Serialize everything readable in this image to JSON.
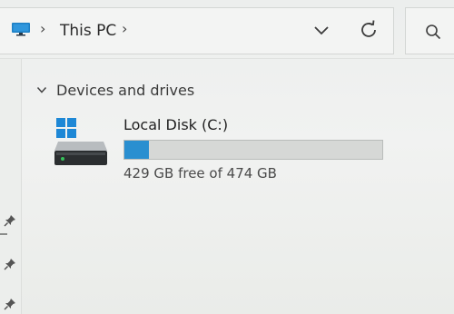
{
  "address_bar": {
    "location_icon": "this-pc-monitor-icon",
    "breadcrumb_separator": "›",
    "location": "This PC",
    "trailing_separator": "›",
    "history_dropdown_icon": "chevron-down-icon",
    "refresh_icon": "refresh-icon"
  },
  "search": {
    "icon": "search-icon"
  },
  "nav_pane": {
    "pin_icons": [
      "pin-icon",
      "pin-icon",
      "pin-icon"
    ]
  },
  "section": {
    "chevron_icon": "chevron-down-icon",
    "title": "Devices and drives"
  },
  "drives": [
    {
      "name": "Local Disk (C:)",
      "icon": "windows-drive-icon",
      "space_text": "429 GB free of 474 GB",
      "used_fraction": 0.095,
      "bar_color": "#2a8fd0"
    }
  ],
  "colors": {
    "accent": "#2a8fd0",
    "windows_logo": "#1e88d6"
  }
}
